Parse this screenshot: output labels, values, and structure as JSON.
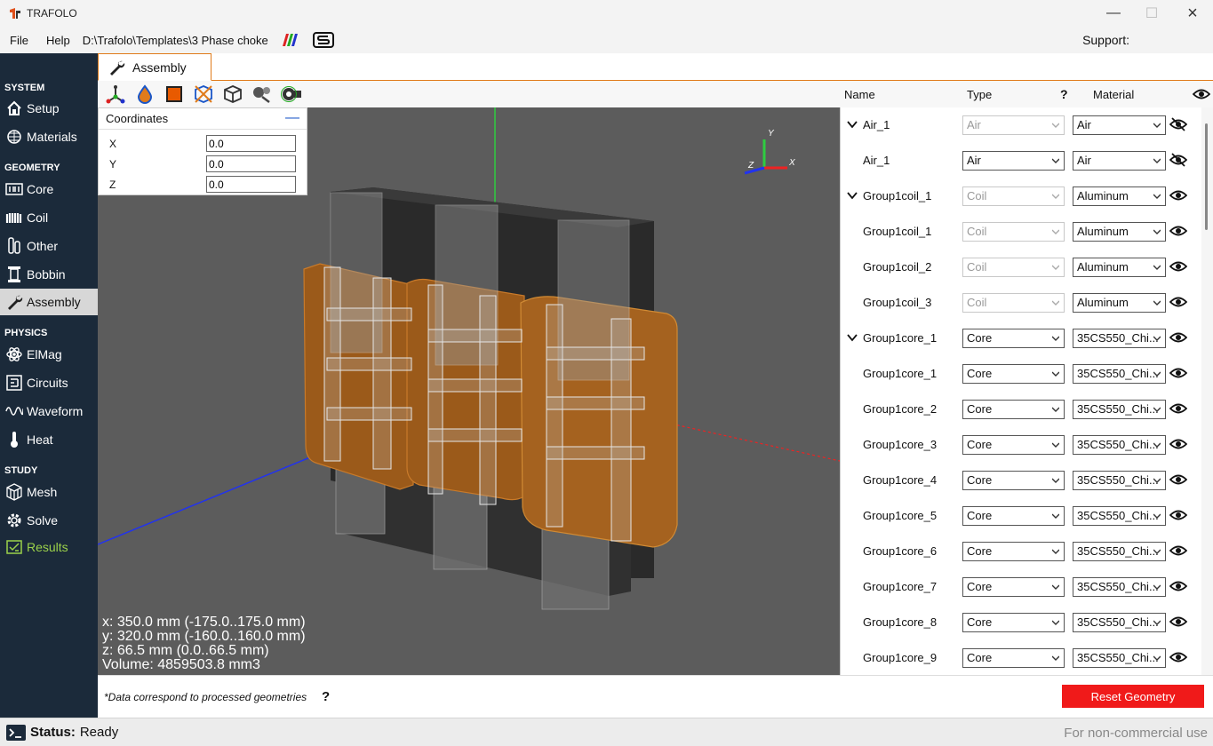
{
  "window": {
    "title": "TRAFOLO"
  },
  "menu": {
    "file": "File",
    "help": "Help",
    "path": "D:\\Trafolo\\Templates\\3 Phase choke",
    "support": "Support:"
  },
  "sidebar": {
    "sections": [
      "SYSTEM",
      "GEOMETRY",
      "PHYSICS",
      "STUDY"
    ],
    "items": [
      {
        "label": "Setup",
        "icon": "home-icon"
      },
      {
        "label": "Materials",
        "icon": "grid-icon"
      },
      {
        "label": "Core",
        "icon": "core-icon"
      },
      {
        "label": "Coil",
        "icon": "coil-icon"
      },
      {
        "label": "Other",
        "icon": "other-icon"
      },
      {
        "label": "Bobbin",
        "icon": "bobbin-icon"
      },
      {
        "label": "Assembly",
        "icon": "wrench-icon"
      },
      {
        "label": "ElMag",
        "icon": "atom-icon"
      },
      {
        "label": "Circuits",
        "icon": "circuit-icon"
      },
      {
        "label": "Waveform",
        "icon": "wave-icon"
      },
      {
        "label": "Heat",
        "icon": "thermometer-icon"
      },
      {
        "label": "Mesh",
        "icon": "mesh-icon"
      },
      {
        "label": "Solve",
        "icon": "gear-icon"
      },
      {
        "label": "Results",
        "icon": "results-icon"
      }
    ],
    "active": "Assembly",
    "accent_color": "#9bd14a"
  },
  "tabs": {
    "assembly": "Assembly"
  },
  "coordinates": {
    "title": "Coordinates",
    "x_label": "X",
    "y_label": "Y",
    "z_label": "Z",
    "x": "0.0",
    "y": "0.0",
    "z": "0.0"
  },
  "axes": {
    "x": "X",
    "y": "Y",
    "z": "Z"
  },
  "dimensions": {
    "x": "x: 350.0 mm (-175.0..175.0 mm)",
    "y": "y: 320.0 mm (-160.0..160.0 mm)",
    "z": "z: 66.5 mm (0.0..66.5 mm)",
    "volume": "Volume: 4859503.8 mm3"
  },
  "table": {
    "headers": {
      "name": "Name",
      "type": "Type",
      "help": "?",
      "material": "Material"
    },
    "rows": [
      {
        "name": "Air_1",
        "type": "Air",
        "material": "Air",
        "group": true,
        "type_disabled": true,
        "visible": false
      },
      {
        "name": "Air_1",
        "type": "Air",
        "material": "Air",
        "group": false,
        "type_disabled": false,
        "visible": false
      },
      {
        "name": "Group1coil_1",
        "type": "Coil",
        "material": "Aluminum",
        "group": true,
        "type_disabled": true,
        "visible": true
      },
      {
        "name": "Group1coil_1",
        "type": "Coil",
        "material": "Aluminum",
        "group": false,
        "type_disabled": true,
        "visible": true
      },
      {
        "name": "Group1coil_2",
        "type": "Coil",
        "material": "Aluminum",
        "group": false,
        "type_disabled": true,
        "visible": true
      },
      {
        "name": "Group1coil_3",
        "type": "Coil",
        "material": "Aluminum",
        "group": false,
        "type_disabled": true,
        "visible": true
      },
      {
        "name": "Group1core_1",
        "type": "Core",
        "material": "35CS550_Chi...",
        "group": true,
        "type_disabled": false,
        "visible": true
      },
      {
        "name": "Group1core_1",
        "type": "Core",
        "material": "35CS550_Chi...",
        "group": false,
        "type_disabled": false,
        "visible": true
      },
      {
        "name": "Group1core_2",
        "type": "Core",
        "material": "35CS550_Chi...",
        "group": false,
        "type_disabled": false,
        "visible": true
      },
      {
        "name": "Group1core_3",
        "type": "Core",
        "material": "35CS550_Chi...",
        "group": false,
        "type_disabled": false,
        "visible": true
      },
      {
        "name": "Group1core_4",
        "type": "Core",
        "material": "35CS550_Chi...",
        "group": false,
        "type_disabled": false,
        "visible": true
      },
      {
        "name": "Group1core_5",
        "type": "Core",
        "material": "35CS550_Chi...",
        "group": false,
        "type_disabled": false,
        "visible": true
      },
      {
        "name": "Group1core_6",
        "type": "Core",
        "material": "35CS550_Chi...",
        "group": false,
        "type_disabled": false,
        "visible": true
      },
      {
        "name": "Group1core_7",
        "type": "Core",
        "material": "35CS550_Chi...",
        "group": false,
        "type_disabled": false,
        "visible": true
      },
      {
        "name": "Group1core_8",
        "type": "Core",
        "material": "35CS550_Chi...",
        "group": false,
        "type_disabled": false,
        "visible": true
      },
      {
        "name": "Group1core_9",
        "type": "Core",
        "material": "35CS550_Chi...",
        "group": false,
        "type_disabled": false,
        "visible": true
      }
    ]
  },
  "footer": {
    "note": "*Data correspond to processed geometries",
    "help": "?",
    "reset": "Reset Geometry",
    "reset_color": "#f01a1a"
  },
  "status": {
    "label": "Status:",
    "value": "Ready",
    "license": "For non-commercial use"
  }
}
